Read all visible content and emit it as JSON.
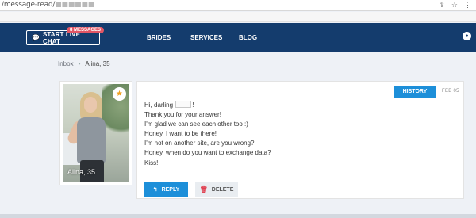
{
  "browser": {
    "url_visible": "/message-read/",
    "url_masked": "■■■■■■"
  },
  "header": {
    "chat_button_label": "START LIVE CHAT",
    "messages_badge": "8 MESSAGES",
    "nav": [
      "BRIDES",
      "SERVICES",
      "BLOG"
    ]
  },
  "breadcrumb": {
    "parent": "Inbox",
    "separator": "•",
    "current": "Alina, 35"
  },
  "profile": {
    "name": "Alina, 35"
  },
  "message": {
    "history_button": "HISTORY",
    "date": "FEB 05",
    "greeting_prefix": "Hi, darling",
    "greeting_suffix": "!",
    "lines": [
      "Thank you for your answer!",
      "I'm glad we can see each other too :)",
      "Honey, I want to be there!",
      "I'm not on another site, are you wrong?",
      "Honey, when do you want to exchange data?",
      "Kiss!"
    ],
    "reply_button": "REPLY",
    "delete_button": "DELETE"
  },
  "colors": {
    "header_bg": "#143c6d",
    "accent": "#1d8fd9",
    "badge": "#e25665"
  }
}
